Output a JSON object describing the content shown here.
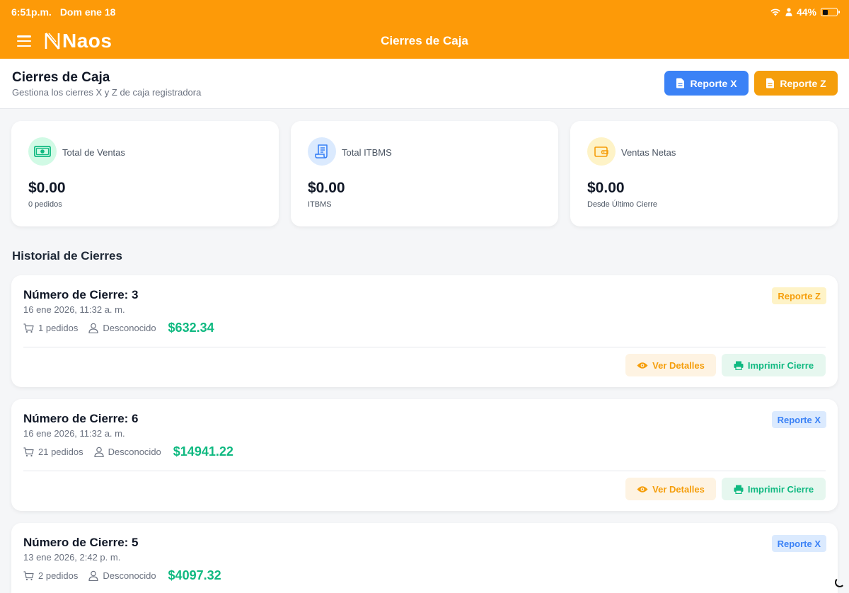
{
  "status_bar": {
    "time": "6:51p.m.",
    "date": "Dom ene 18",
    "battery_pct": "44%",
    "battery_level": 0.44
  },
  "nav": {
    "logo_text": "Naos",
    "title": "Cierres de Caja"
  },
  "header": {
    "title": "Cierres de Caja",
    "subtitle": "Gestiona los cierres X y Z de caja registradora",
    "btn_x_label": "Reporte X",
    "btn_z_label": "Reporte Z"
  },
  "summary": [
    {
      "icon": "money-icon",
      "label": "Total de Ventas",
      "value": "$0.00",
      "sub": "0 pedidos",
      "icon_bg": "#d1fae5",
      "icon_color": "#10b981"
    },
    {
      "icon": "receipt-icon",
      "label": "Total ITBMS",
      "value": "$0.00",
      "sub": "ITBMS",
      "icon_bg": "#dbeafe",
      "icon_color": "#3b82f6"
    },
    {
      "icon": "wallet-icon",
      "label": "Ventas Netas",
      "value": "$0.00",
      "sub": "Desde Último Cierre",
      "icon_bg": "#fef3c7",
      "icon_color": "#f59e0b"
    }
  ],
  "history": {
    "title": "Historial de Cierres",
    "details_label": "Ver Detalles",
    "print_label": "Imprimir Cierre",
    "items": [
      {
        "number": "Número de Cierre: 3",
        "date": "16 ene 2026, 11:32 a. m.",
        "orders": "1 pedidos",
        "user": "Desconocido",
        "amount": "$632.34",
        "badge": "Reporte Z"
      },
      {
        "number": "Número de Cierre: 6",
        "date": "16 ene 2026, 11:32 a. m.",
        "orders": "21 pedidos",
        "user": "Desconocido",
        "amount": "$14941.22",
        "badge": "Reporte X"
      },
      {
        "number": "Número de Cierre: 5",
        "date": "13 ene 2026, 2:42 p. m.",
        "orders": "2 pedidos",
        "user": "Desconocido",
        "amount": "$4097.32",
        "badge": "Reporte X"
      }
    ]
  },
  "colors": {
    "brand": "#fd9a08",
    "primary": "#3b82f6",
    "warning": "#f59e0b",
    "success": "#10b981"
  }
}
